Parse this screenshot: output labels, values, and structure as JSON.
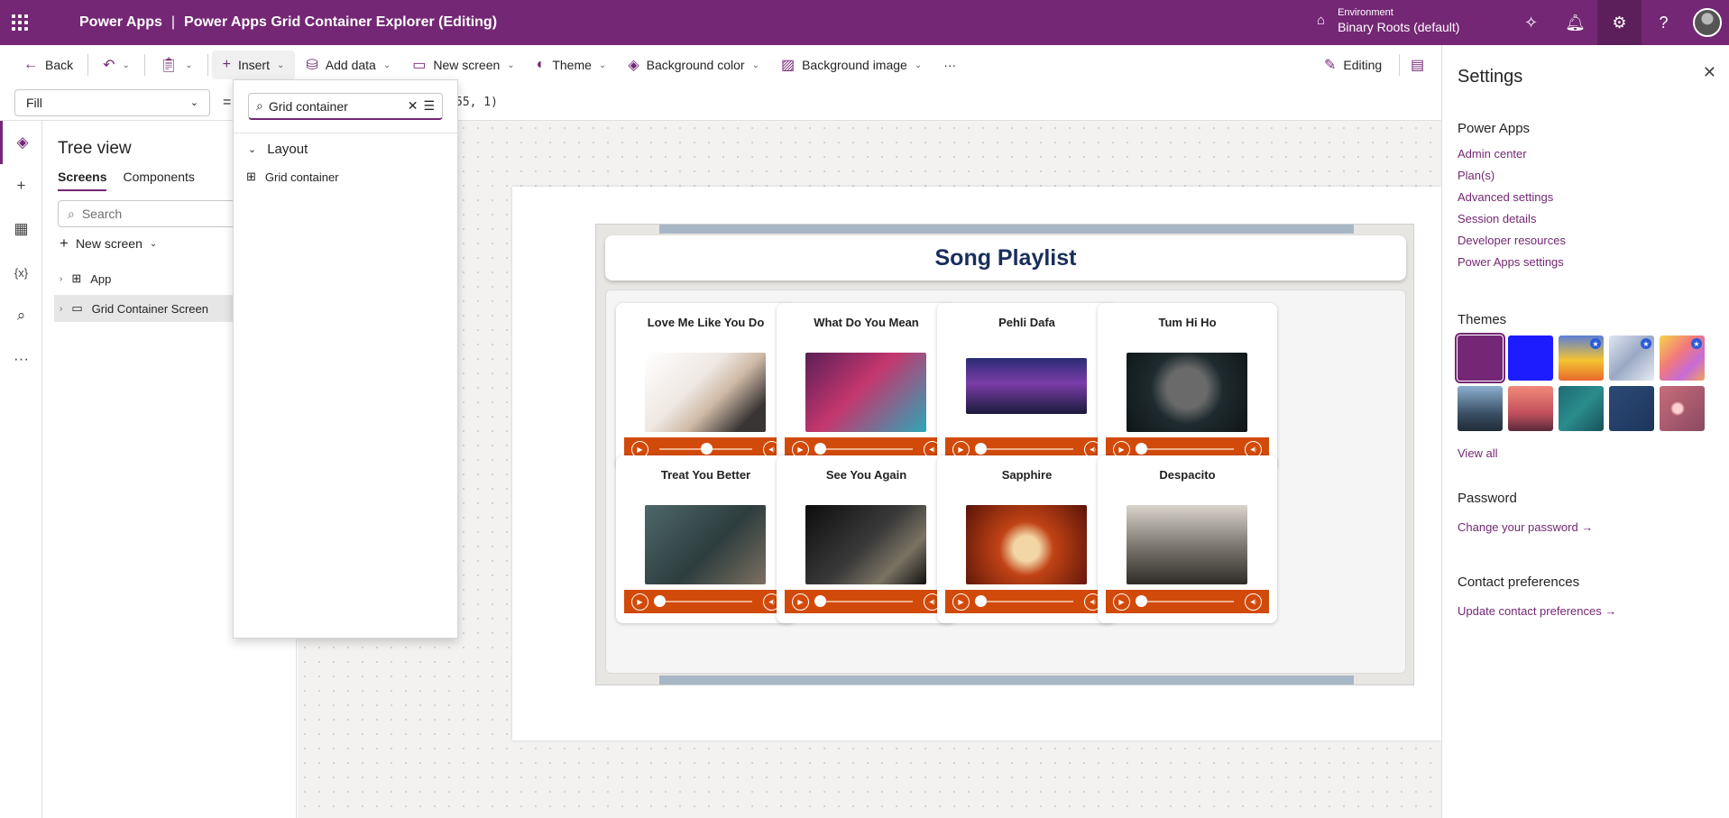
{
  "topbar": {
    "app_name": "Power Apps",
    "separator": "|",
    "doc_title": "Power Apps Grid Container Explorer (Editing)",
    "env_label": "Environment",
    "env_name": "Binary Roots (default)"
  },
  "cmdbar": {
    "back": "Back",
    "insert": "Insert",
    "add_data": "Add data",
    "new_screen": "New screen",
    "theme": "Theme",
    "background_color": "Background color",
    "background_image": "Background image",
    "more": "···",
    "editing": "Editing"
  },
  "formula": {
    "property": "Fill",
    "equals": "=",
    "text": "55, 1)"
  },
  "treeview": {
    "title": "Tree view",
    "tabs": [
      "Screens",
      "Components"
    ],
    "search_placeholder": "Search",
    "new_screen": "New screen",
    "items": [
      "App",
      "Grid Container Screen"
    ]
  },
  "insert_panel": {
    "search_value": "Grid container",
    "category": "Layout",
    "item": "Grid container"
  },
  "app": {
    "title": "Song Playlist",
    "songs": [
      {
        "title": "Love Me Like You Do",
        "progress": 0.5
      },
      {
        "title": "What Do You Mean",
        "progress": 0.0
      },
      {
        "title": "Pehli Dafa",
        "progress": 0.0
      },
      {
        "title": "Tum Hi Ho",
        "progress": 0.0
      },
      {
        "title": "Treat You Better",
        "progress": 0.0
      },
      {
        "title": "See You Again",
        "progress": 0.0
      },
      {
        "title": "Sapphire",
        "progress": 0.0
      },
      {
        "title": "Despacito",
        "progress": 0.0
      }
    ]
  },
  "settings": {
    "title": "Settings",
    "power_apps_heading": "Power Apps",
    "links": [
      "Admin center",
      "Plan(s)",
      "Advanced settings",
      "Session details",
      "Developer resources",
      "Power Apps settings"
    ],
    "themes_heading": "Themes",
    "view_all": "View all",
    "password_heading": "Password",
    "change_password": "Change your password →",
    "contact_heading": "Contact preferences",
    "update_contact": "Update contact preferences →"
  },
  "colors": {
    "brand": "#742774",
    "player": "#d24a0a",
    "playlist_title": "#1a2e5a"
  }
}
